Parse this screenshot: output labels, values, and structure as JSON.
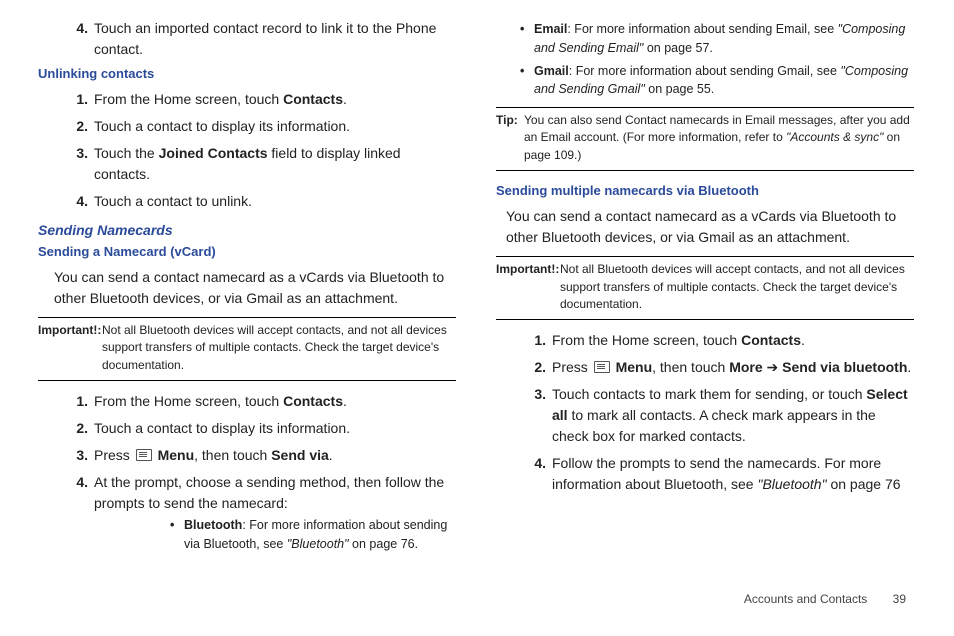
{
  "col1": {
    "step4a": "Touch an imported contact record to link it to the Phone contact.",
    "h_unlink": "Unlinking contacts",
    "unlink": {
      "s1a": "From the Home screen, touch ",
      "s1b": "Contacts",
      "s1c": ".",
      "s2": "Touch a contact to display its information.",
      "s3a": "Touch the ",
      "s3b": "Joined Contacts",
      "s3c": " field to display linked contacts.",
      "s4": "Touch a contact to unlink."
    },
    "h_send": "Sending Namecards",
    "h_vcard": "Sending a Namecard (vCard)",
    "body": "You can send a contact namecard as a vCards via Bluetooth to other Bluetooth devices, or via Gmail as an attachment.",
    "imp_lbl": "Important!:",
    "imp_txt": "Not all Bluetooth devices will accept contacts, and not all devices support transfers of multiple contacts. Check the target device's documentation.",
    "steps": {
      "s1a": "From the Home screen, touch ",
      "s1b": "Contacts",
      "s1c": ".",
      "s2": "Touch a contact to display its information.",
      "s3a": "Press ",
      "s3b": "Menu",
      "s3c": ", then touch ",
      "s3d": "Send via",
      "s3e": ".",
      "s4": "At the prompt, choose a sending method, then follow the prompts to send the namecard:"
    },
    "bul": {
      "bt_b": "Bluetooth",
      "bt_t1": ": For more information about sending via Bluetooth, see ",
      "bt_q": "\"Bluetooth\"",
      "bt_t2": " on page 76."
    }
  },
  "col2": {
    "bul": {
      "em_b": "Email",
      "em_t1": ": For more information about sending Email, see ",
      "em_q": "\"Composing and Sending Email\"",
      "em_t2": " on page 57.",
      "gm_b": "Gmail",
      "gm_t1": ": For more information about sending Gmail, see ",
      "gm_q": "\"Composing and Sending Gmail\"",
      "gm_t2": " on page 55."
    },
    "tip_lbl": "Tip:",
    "tip_t1": "You can also send Contact namecards in Email messages, after you add an Email account. (For more information, refer to ",
    "tip_q": "\"Accounts & sync\"",
    "tip_t2": " on page 109.)",
    "h_multi": "Sending multiple namecards via Bluetooth",
    "body": "You can send a contact namecard as a vCards via Bluetooth to other Bluetooth devices, or via Gmail as an attachment.",
    "imp_lbl": "Important!:",
    "imp_txt": "Not all Bluetooth devices will accept contacts, and not all devices support transfers of multiple contacts. Check the target device's documentation.",
    "steps": {
      "s1a": "From the Home screen, touch ",
      "s1b": "Contacts",
      "s1c": ".",
      "s2a": "Press ",
      "s2b": "Menu",
      "s2c": ", then touch ",
      "s2d": "More",
      "s2e": " ➔ ",
      "s2f": "Send via bluetooth",
      "s2g": ".",
      "s3a": "Touch contacts to mark them for sending, or touch ",
      "s3b": "Select all",
      "s3c": " to mark all contacts. A check mark appears in the check box for marked contacts.",
      "s4a": "Follow the prompts to send the namecards. For more information about Bluetooth, see ",
      "s4q": "\"Bluetooth\"",
      "s4b": " on page 76"
    }
  },
  "footer": {
    "section": "Accounts and Contacts",
    "page": "39"
  }
}
